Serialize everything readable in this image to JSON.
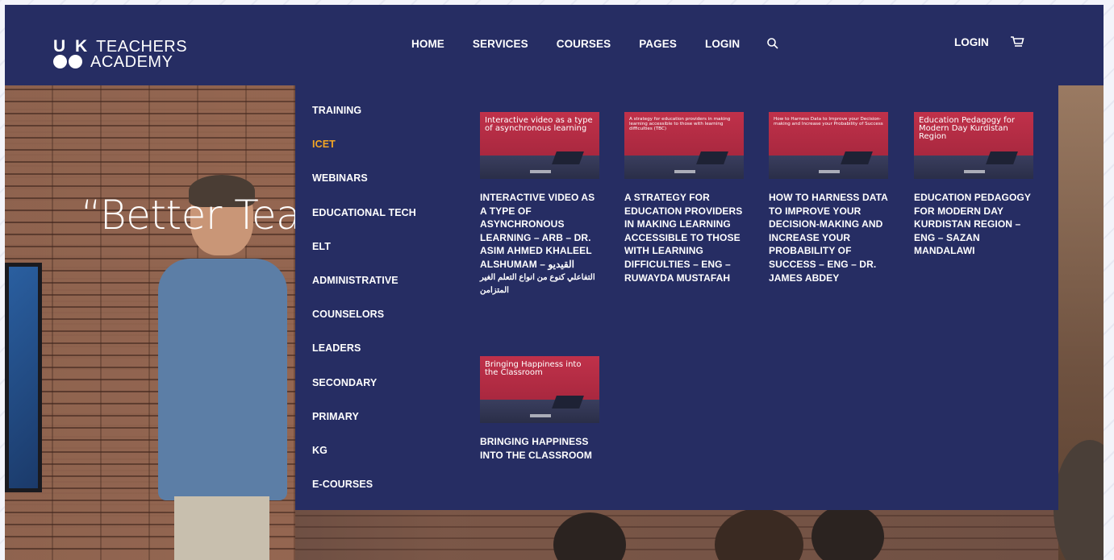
{
  "brand": {
    "line1_prefix": "U K",
    "line1_rest": "TEACHERS",
    "line2": "ACADEMY"
  },
  "nav": {
    "items": [
      {
        "label": "HOME"
      },
      {
        "label": "SERVICES"
      },
      {
        "label": "COURSES"
      },
      {
        "label": "PAGES"
      },
      {
        "label": "LOGIN"
      }
    ],
    "search_icon": "search-icon",
    "right_login": "LOGIN",
    "cart_icon": "cart-icon"
  },
  "hero": {
    "headline": "“Better Tea"
  },
  "mega_menu": {
    "categories": [
      {
        "label": "TRAINING"
      },
      {
        "label": "ICET",
        "active": true
      },
      {
        "label": "WEBINARS"
      },
      {
        "label": "EDUCATIONAL TECH"
      },
      {
        "label": "ELT"
      },
      {
        "label": "ADMINISTRATIVE"
      },
      {
        "label": "COUNSELORS"
      },
      {
        "label": "LEADERS"
      },
      {
        "label": "SECONDARY"
      },
      {
        "label": "PRIMARY"
      },
      {
        "label": "KG"
      },
      {
        "label": "E-COURSES"
      }
    ],
    "active_color": "#f5a623",
    "courses": [
      {
        "thumb_text": "Interactive video as a type of asynchronous learning",
        "title": "INTERACTIVE VIDEO AS A TYPE OF ASYNCHRONOUS LEARNING – ARB – DR. ASIM AHMED KHALEEL ALSHUMAM – القيديو",
        "title_ar": "التفاعلي كنوع من انواع التعلم الغير المتزامن"
      },
      {
        "thumb_text": "A strategy for education providers in making learning accessible to those with learning difficulties (TBC)",
        "title": "A STRATEGY FOR EDUCATION PROVIDERS IN MAKING LEARNING ACCESSIBLE TO THOSE WITH LEARNING DIFFICULTIES – ENG – RUWAYDA MUSTAFAH"
      },
      {
        "thumb_text": "How to Harness Data to Improve your Decision-making and Increase your Probability of Success",
        "title": "HOW TO HARNESS DATA TO IMPROVE YOUR DECISION-MAKING AND INCREASE YOUR PROBABILITY OF SUCCESS – ENG – DR. JAMES ABDEY"
      },
      {
        "thumb_text": "Education Pedagogy for Modern Day Kurdistan Region",
        "title": "EDUCATION PEDAGOGY FOR MODERN DAY KURDISTAN REGION – ENG – SAZAN MANDALAWI"
      },
      {
        "thumb_text": "Bringing Happiness into the Classroom",
        "title": "BRINGING HAPPINESS INTO THE CLASSROOM"
      }
    ]
  },
  "colors": {
    "header_bg": "#262d63",
    "thumb_red": "#c0314a"
  }
}
